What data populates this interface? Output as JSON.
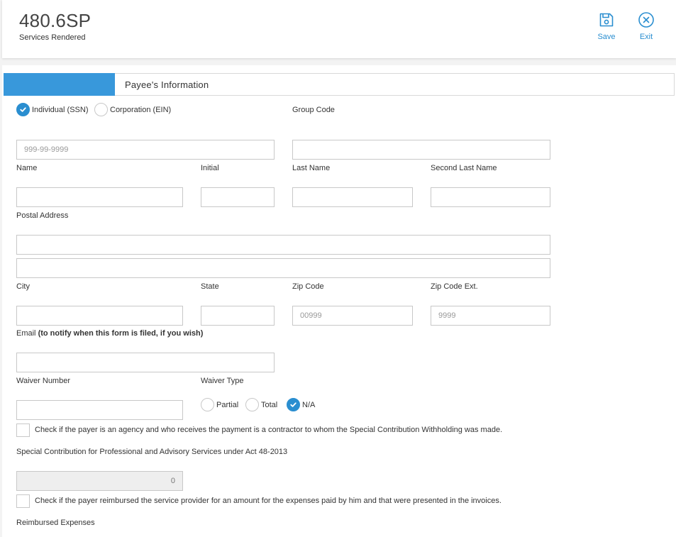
{
  "header": {
    "title": "480.6SP",
    "subtitle": "Services Rendered",
    "save_label": "Save",
    "exit_label": "Exit"
  },
  "tab": {
    "label": "Payee's Information"
  },
  "colors": {
    "accent": "#3898db",
    "link": "#2a8ed0"
  },
  "taxpayer_type": {
    "options": [
      {
        "label": "Individual (SSN)",
        "selected": true
      },
      {
        "label": "Corporation (EIN)",
        "selected": false
      }
    ],
    "id_placeholder": "999-99-9999"
  },
  "fields": {
    "group_code": "Group Code",
    "name": "Name",
    "initial": "Initial",
    "last_name": "Last Name",
    "second_last_name": "Second Last Name",
    "postal_address": "Postal Address",
    "city": "City",
    "state": "State",
    "zip_code": "Zip Code",
    "zip_placeholder": "00999",
    "zip_ext": "Zip Code Ext.",
    "zip_ext_placeholder": "9999",
    "email": "Email",
    "email_note": "(to notify when this form is filed, if you wish)",
    "waiver_number": "Waiver Number",
    "waiver_type": "Waiver Type"
  },
  "waiver_type_options": [
    {
      "label": "Partial",
      "selected": false
    },
    {
      "label": "Total",
      "selected": false
    },
    {
      "label": "N/A",
      "selected": true
    }
  ],
  "agency_check": {
    "label": "Check if the payer is an agency and who receives the payment is a contractor to whom the Special Contribution Withholding was made.",
    "checked": false
  },
  "special_contribution": {
    "label": "Special Contribution for Professional and Advisory Services under Act 48-2013",
    "value": "0"
  },
  "reimbursed_check": {
    "label": "Check if the payer reimbursed the service provider for an amount for the expenses paid by him and that were presented in the invoices.",
    "checked": false
  },
  "reimbursed_expenses": {
    "label": "Reimbursed Expenses"
  }
}
